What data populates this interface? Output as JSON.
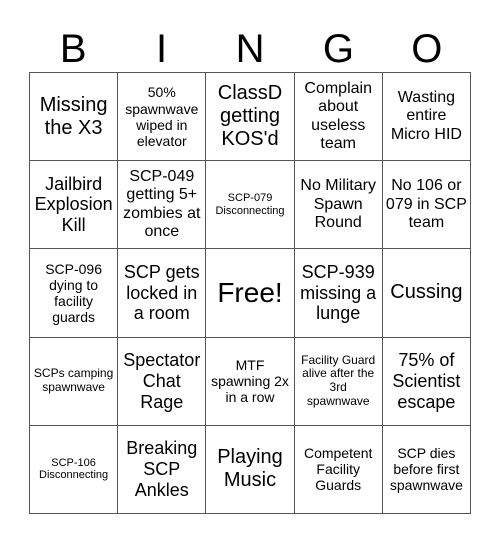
{
  "header": {
    "letters": [
      "B",
      "I",
      "N",
      "G",
      "O"
    ]
  },
  "colors": {
    "background": "#ffffff",
    "text": "#000000",
    "grid_line": "#555555"
  },
  "cells": [
    [
      "Missing the X3",
      "50% spawnwave wiped in elevator",
      "ClassD getting KOS'd",
      "Complain about useless team",
      "Wasting entire Micro HID"
    ],
    [
      "Jailbird Explosion Kill",
      "SCP-049 getting 5+ zombies at once",
      "SCP-079 Disconnecting",
      "No Military Spawn Round",
      "No 106 or 079 in SCP team"
    ],
    [
      "SCP-096 dying to facility guards",
      "SCP gets locked in a room",
      "Free!",
      "SCP-939 missing a lunge",
      "Cussing"
    ],
    [
      "SCPs camping spawnwave",
      "Spectator Chat Rage",
      "MTF spawning 2x in a row",
      "Facility Guard alive after the 3rd spawnwave",
      "75% of Scientist escape"
    ],
    [
      "SCP-106 Disconnecting",
      "Breaking SCP Ankles",
      "Playing Music",
      "Competent Facility Guards",
      "SCP dies before first spawnwave"
    ]
  ]
}
